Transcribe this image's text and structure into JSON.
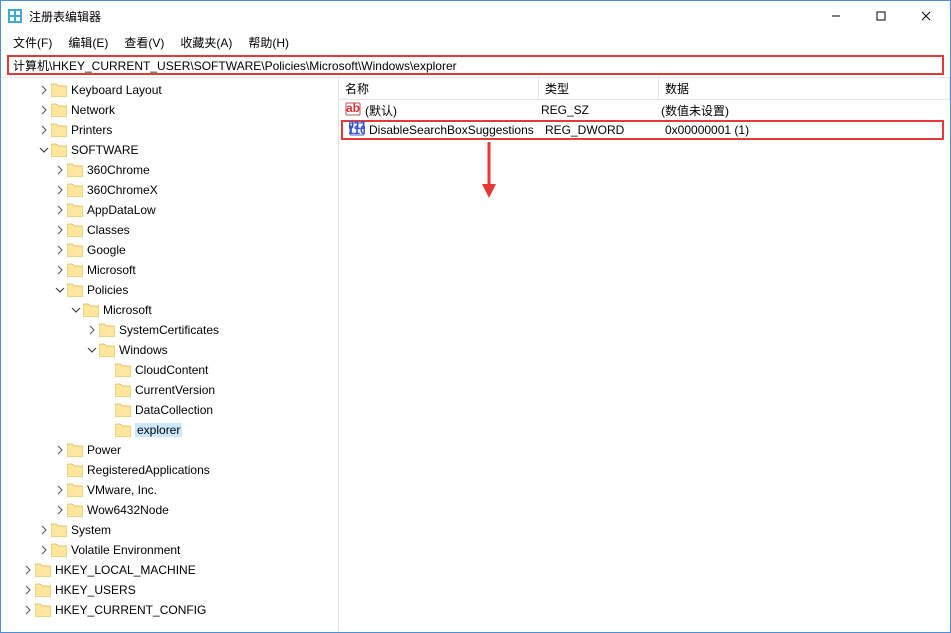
{
  "window": {
    "title": "注册表编辑器"
  },
  "menu": {
    "file": "文件(F)",
    "edit": "编辑(E)",
    "view": "查看(V)",
    "favorites": "收藏夹(A)",
    "help": "帮助(H)"
  },
  "address": {
    "path": "计算机\\HKEY_CURRENT_USER\\SOFTWARE\\Policies\\Microsoft\\Windows\\explorer"
  },
  "list": {
    "headers": {
      "name": "名称",
      "type": "类型",
      "data": "数据"
    },
    "rows": [
      {
        "icon": "sz",
        "name": "(默认)",
        "type": "REG_SZ",
        "data": "(数值未设置)",
        "highlight": false
      },
      {
        "icon": "dword",
        "name": "DisableSearchBoxSuggestions",
        "type": "REG_DWORD",
        "data": "0x00000001 (1)",
        "highlight": true
      }
    ]
  },
  "tree": {
    "root": "计算机",
    "hkcu": "HKEY_CURRENT_USER",
    "items_top": [
      {
        "label": "Keyboard Layout",
        "exp": "right"
      },
      {
        "label": "Network",
        "exp": "right"
      },
      {
        "label": "Printers",
        "exp": "right"
      }
    ],
    "software": "SOFTWARE",
    "software_children": [
      {
        "label": "360Chrome",
        "exp": "right"
      },
      {
        "label": "360ChromeX",
        "exp": "right"
      },
      {
        "label": "AppDataLow",
        "exp": "right"
      },
      {
        "label": "Classes",
        "exp": "right"
      },
      {
        "label": "Google",
        "exp": "right"
      },
      {
        "label": "Microsoft",
        "exp": "right"
      }
    ],
    "policies": "Policies",
    "microsoft": "Microsoft",
    "syscert": "SystemCertificates",
    "windows": "Windows",
    "windows_children": [
      {
        "label": "CloudContent"
      },
      {
        "label": "CurrentVersion"
      },
      {
        "label": "DataCollection"
      },
      {
        "label": "explorer",
        "selected": true
      }
    ],
    "after_policies": [
      {
        "label": "Power",
        "exp": "right"
      },
      {
        "label": "RegisteredApplications",
        "exp": "none"
      },
      {
        "label": "VMware, Inc.",
        "exp": "right"
      },
      {
        "label": "Wow6432Node",
        "exp": "right"
      }
    ],
    "after_software": [
      {
        "label": "System",
        "exp": "right"
      },
      {
        "label": "Volatile Environment",
        "exp": "right"
      }
    ],
    "roots_after": [
      {
        "label": "HKEY_LOCAL_MACHINE",
        "exp": "right"
      },
      {
        "label": "HKEY_USERS",
        "exp": "right"
      },
      {
        "label": "HKEY_CURRENT_CONFIG",
        "exp": "right"
      }
    ]
  }
}
